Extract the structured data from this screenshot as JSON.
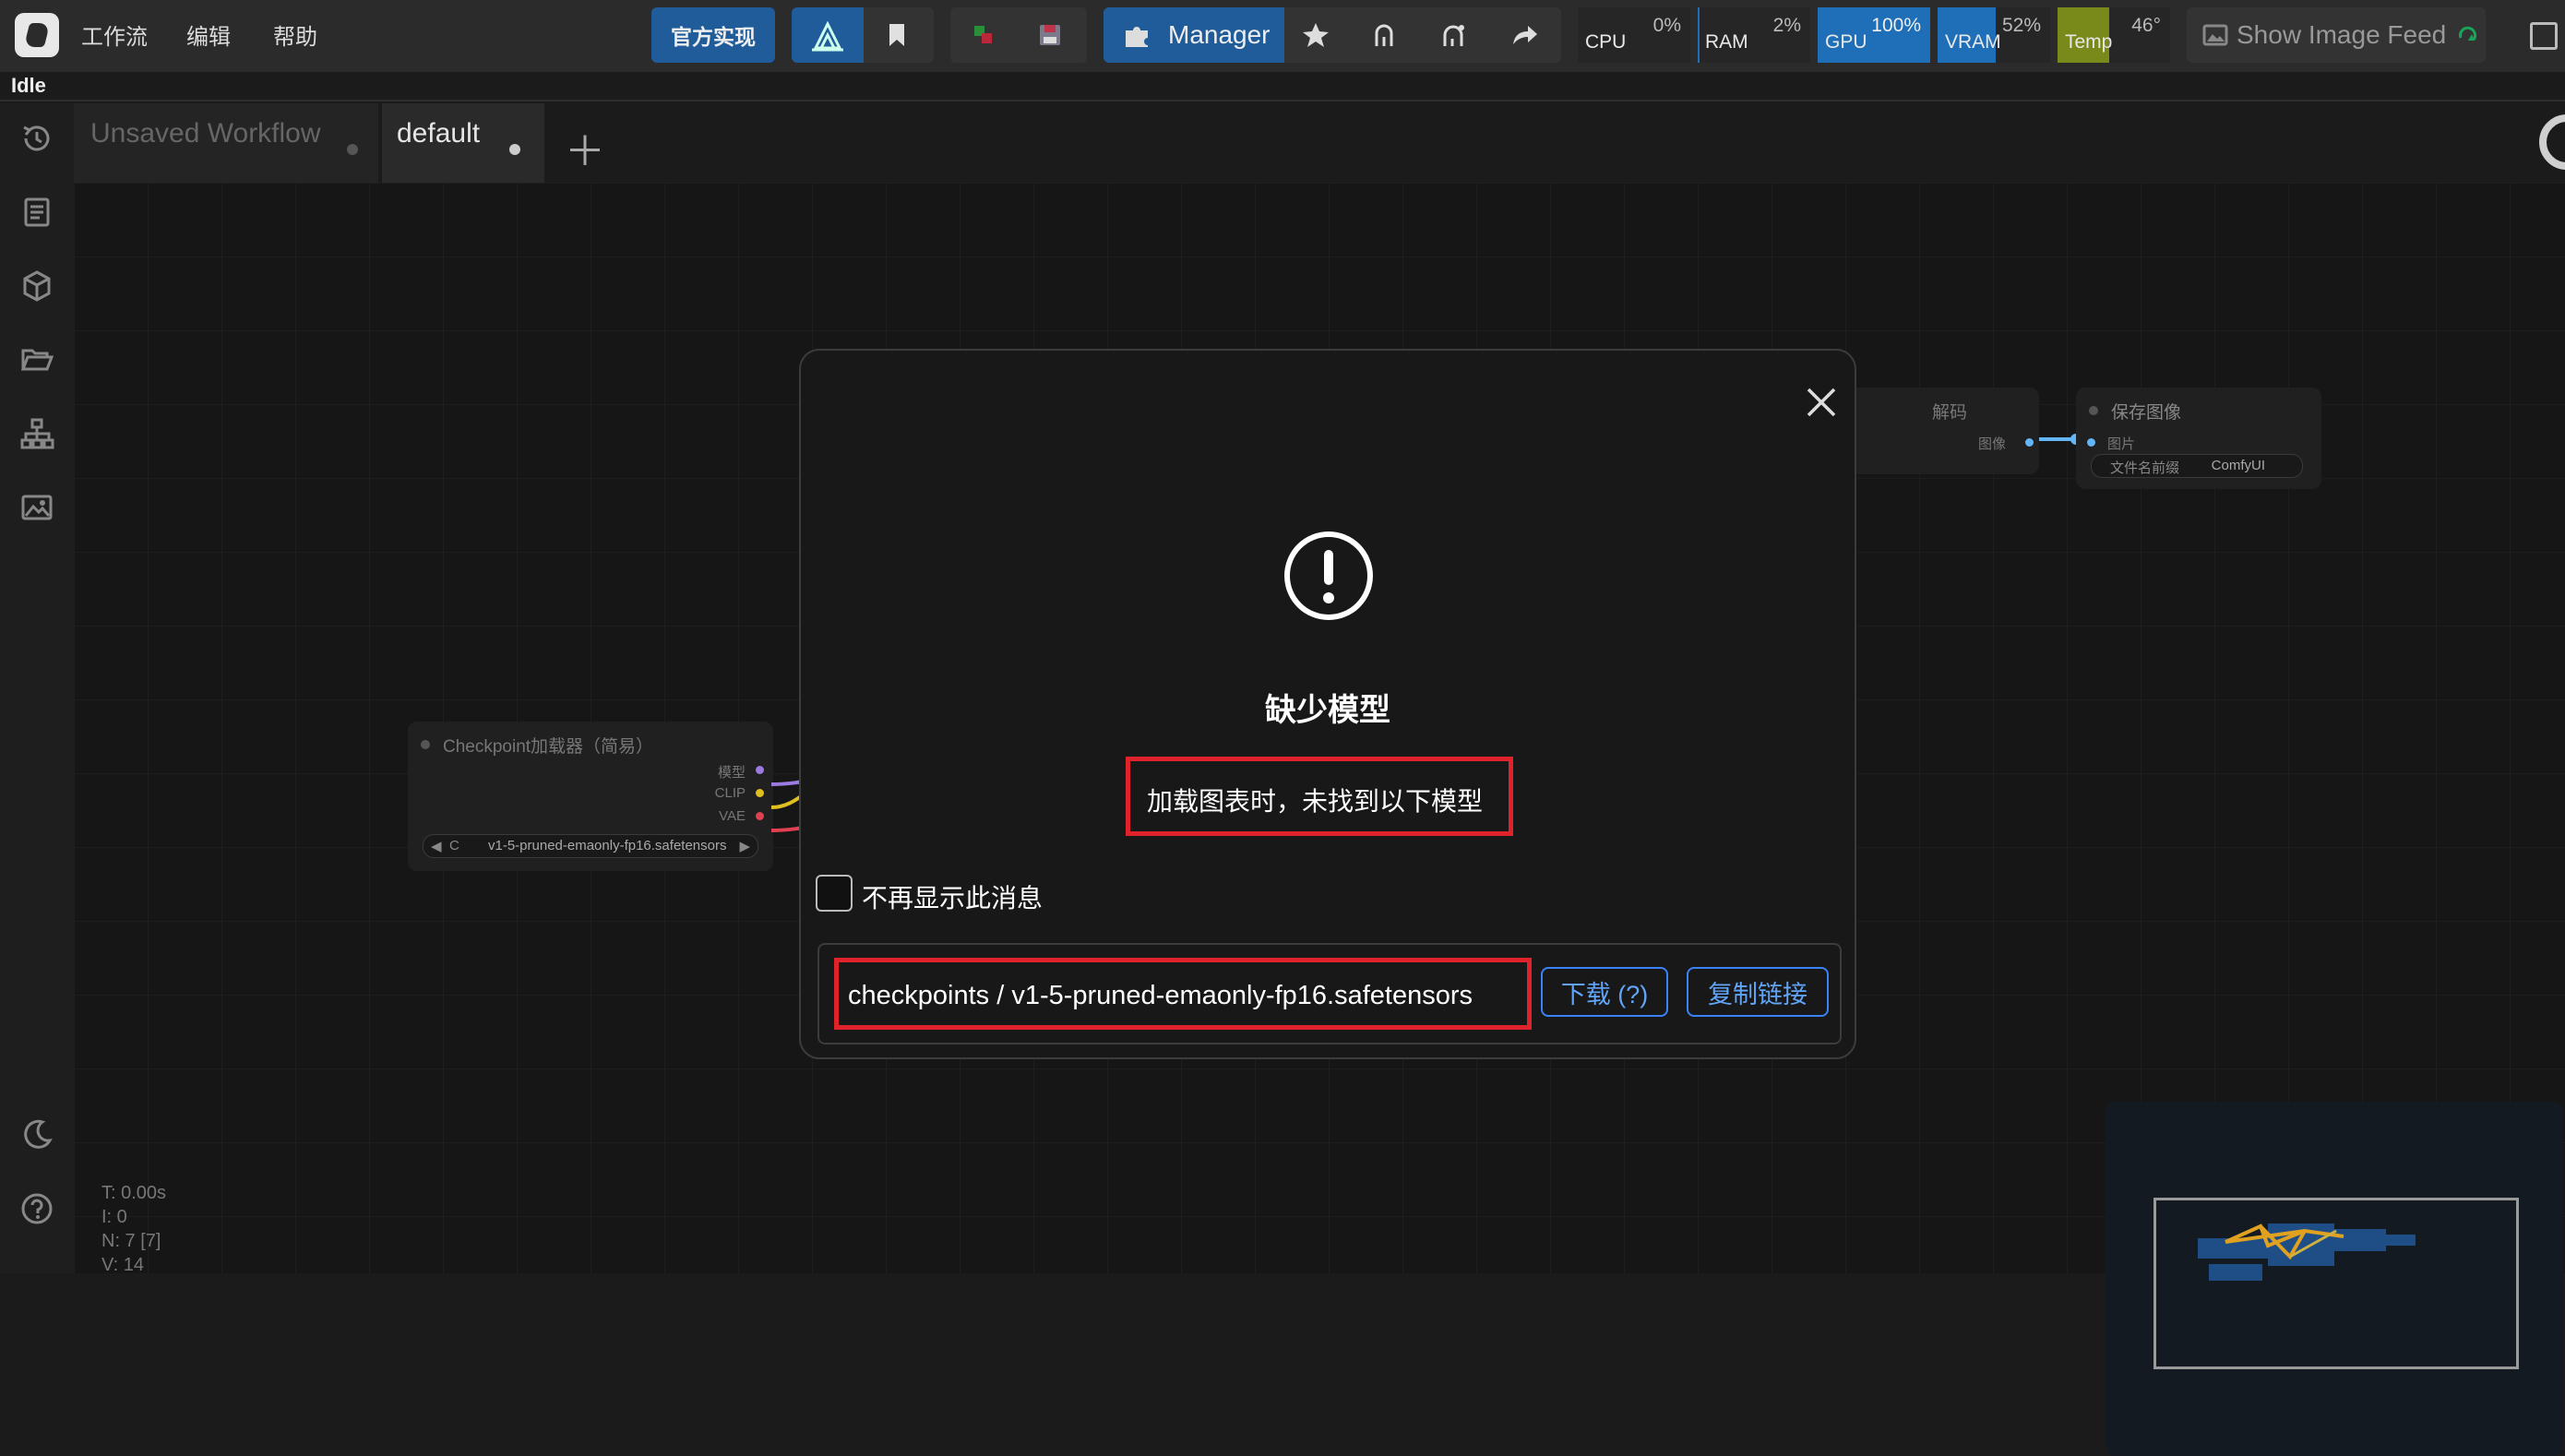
{
  "menu": {
    "workflow": "工作流",
    "edit": "编辑",
    "help": "帮助"
  },
  "toolbar": {
    "official": "官方实现",
    "manager": "Manager",
    "image_feed": "Show Image Feed"
  },
  "monitor": [
    {
      "label": "CPU",
      "value": "0%",
      "level": 0.0,
      "color": "#1f6fb8"
    },
    {
      "label": "RAM",
      "value": "2%",
      "level": 0.02,
      "color": "#1f6fb8"
    },
    {
      "label": "GPU",
      "value": "100%",
      "level": 1.0,
      "color": "#1f6fb8"
    },
    {
      "label": "VRAM",
      "value": "52%",
      "level": 0.52,
      "color": "#1f6fb8"
    },
    {
      "label": "Temp",
      "value": "46°",
      "level": 0.46,
      "color": "#7a8a1a"
    }
  ],
  "status": "Idle",
  "tabs": [
    {
      "label": "Unsaved Workflow",
      "active": false
    },
    {
      "label": "default",
      "active": true
    }
  ],
  "nodes": {
    "checkpoint": {
      "title": "Checkpoint加载器（简易）",
      "outputs": [
        "模型",
        "CLIP",
        "VAE"
      ],
      "widget_prefix": "C",
      "widget_value": "v1-5-pruned-emaonly-fp16.safetensors"
    },
    "decode": {
      "title": "解码",
      "output": "图像"
    },
    "save": {
      "title": "保存图像",
      "input": "图片",
      "widget_label": "文件名前缀",
      "widget_value": "ComfyUI"
    }
  },
  "stats": {
    "t": "T: 0.00s",
    "i": "I: 0",
    "n": "N: 7 [7]",
    "v": "V: 14"
  },
  "dialog": {
    "title": "缺少模型",
    "message": "加载图表时，未找到以下模型",
    "checkbox_label": "不再显示此消息",
    "model": "checkpoints / v1-5-pruned-emaonly-fp16.safetensors",
    "download": "下载 (?)",
    "copy_link": "复制链接"
  },
  "colors": {
    "accent": "#1f5c99",
    "highlight": "#e0232a",
    "link": "#60a5fa"
  }
}
